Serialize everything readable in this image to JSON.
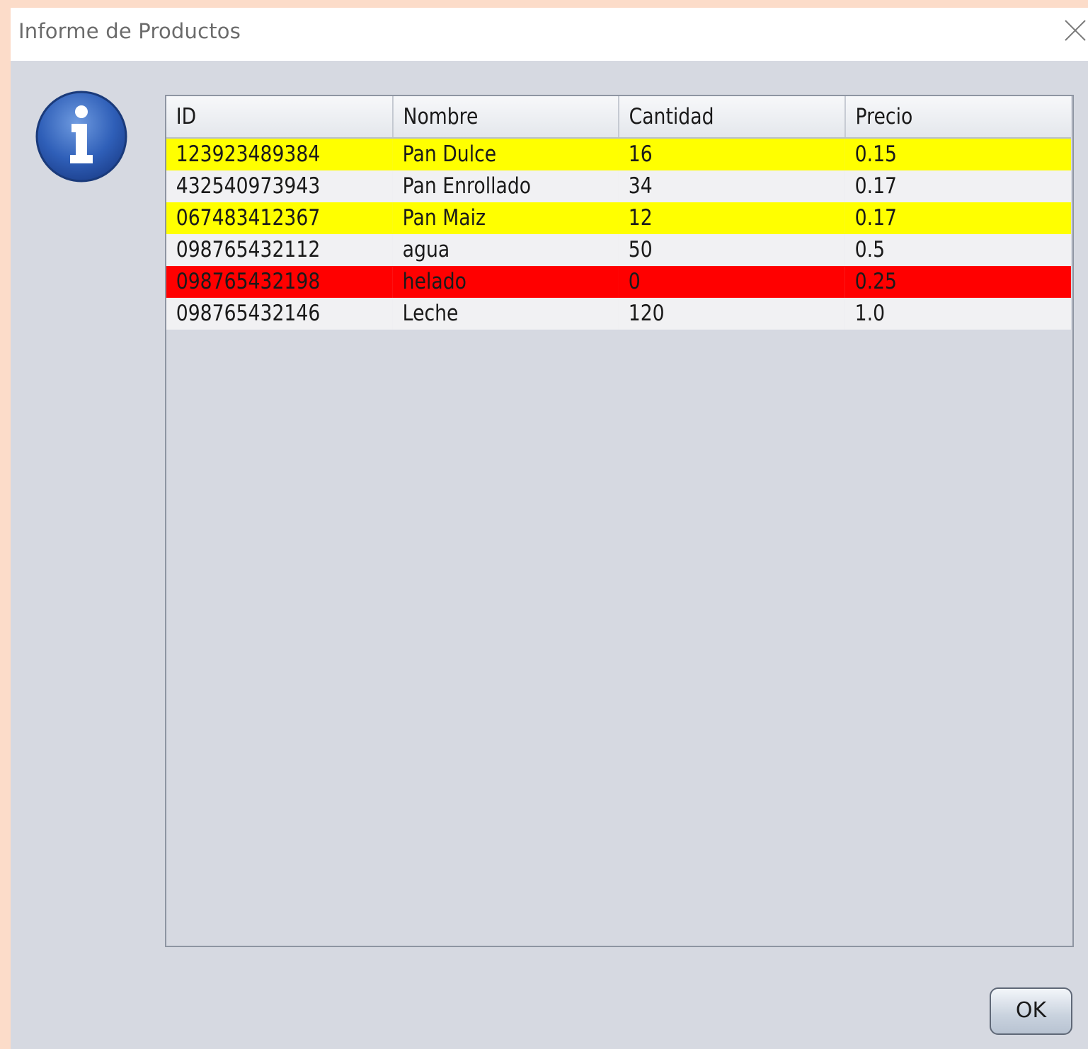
{
  "window": {
    "title": "Informe de Productos",
    "close_icon": "close-icon"
  },
  "dialog": {
    "icon": "info-icon",
    "ok_label": "OK"
  },
  "table": {
    "columns": [
      "ID",
      "Nombre",
      "Cantidad",
      "Precio"
    ],
    "rows": [
      {
        "id": "123923489384",
        "nombre": "Pan Dulce",
        "cantidad": "16",
        "precio": "0.15",
        "highlight": "#ffff00"
      },
      {
        "id": "432540973943",
        "nombre": "Pan Enrollado",
        "cantidad": "34",
        "precio": "0.17",
        "highlight": "#f1f1f3"
      },
      {
        "id": "067483412367",
        "nombre": "Pan Maiz",
        "cantidad": "12",
        "precio": "0.17",
        "highlight": "#ffff00"
      },
      {
        "id": "098765432112",
        "nombre": "agua",
        "cantidad": "50",
        "precio": "0.5",
        "highlight": "#f1f1f3"
      },
      {
        "id": "098765432198",
        "nombre": "helado",
        "cantidad": "0",
        "precio": "0.25",
        "highlight": "#ff0000"
      },
      {
        "id": "098765432146",
        "nombre": "Leche",
        "cantidad": "120",
        "precio": "1.0",
        "highlight": "#f1f1f3"
      }
    ]
  },
  "colors": {
    "background": "#fcdcc9",
    "dialog": "#d6d9e1",
    "low_stock": "#ffff00",
    "out_of_stock": "#ff0000"
  }
}
